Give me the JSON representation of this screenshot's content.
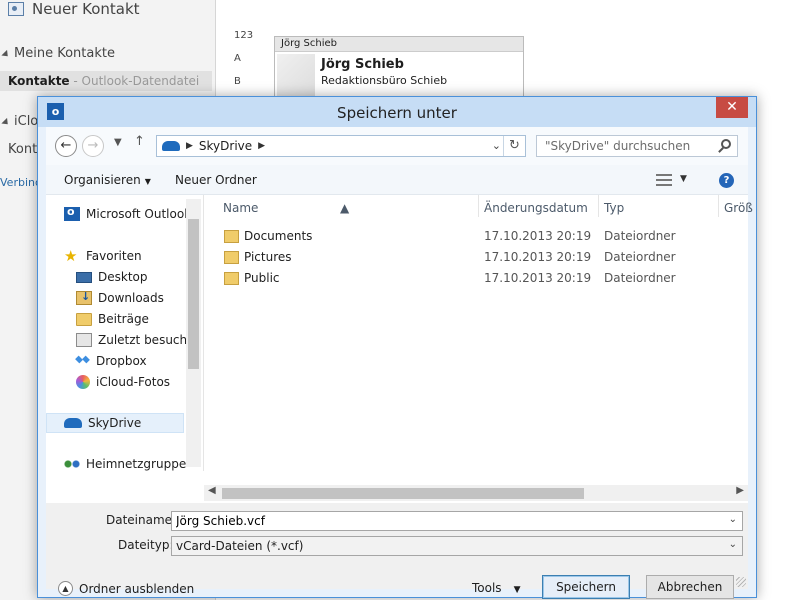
{
  "background": {
    "title": "Neuer Kontakt",
    "group1": "Meine Kontakte",
    "selected_item": "Kontakte",
    "selected_item_sub": " - Outlook-Datendatei",
    "group2": "iClou",
    "item2": "Konta",
    "link": "Verbind",
    "letters": [
      "123",
      "A",
      "B"
    ],
    "card": {
      "header": "Jörg Schieb",
      "name": "Jörg Schieb",
      "company": "Redaktionsbüro Schieb"
    }
  },
  "dialog": {
    "title": "Speichern unter",
    "close": "✕",
    "address": {
      "location": "SkyDrive"
    },
    "search_placeholder": "\"SkyDrive\" durchsuchen",
    "toolbar": {
      "organize": "Organisieren",
      "new_folder": "Neuer Ordner",
      "help": "?"
    },
    "nav": {
      "root": "Microsoft Outlook",
      "favorites": "Favoriten",
      "items": [
        "Desktop",
        "Downloads",
        "Beiträge",
        "Zuletzt besucht",
        "Dropbox",
        "iCloud-Fotos"
      ],
      "selected": "SkyDrive",
      "homegroup": "Heimnetzgruppe"
    },
    "columns": {
      "name": "Name",
      "date": "Änderungsdatum",
      "type": "Typ",
      "size": "Größ"
    },
    "files": [
      {
        "name": "Documents",
        "date": "17.10.2013 20:19",
        "type": "Dateiordner"
      },
      {
        "name": "Pictures",
        "date": "17.10.2013 20:19",
        "type": "Dateiordner"
      },
      {
        "name": "Public",
        "date": "17.10.2013 20:19",
        "type": "Dateiordner"
      }
    ],
    "form": {
      "filename_label": "Dateiname:",
      "filename_value": "Jörg Schieb.vcf",
      "filetype_label": "Dateityp:",
      "filetype_value": "vCard-Dateien (*.vcf)"
    },
    "footer": {
      "hide_folders": "Ordner ausblenden",
      "tools": "Tools",
      "save": "Speichern",
      "cancel": "Abbrechen"
    }
  }
}
